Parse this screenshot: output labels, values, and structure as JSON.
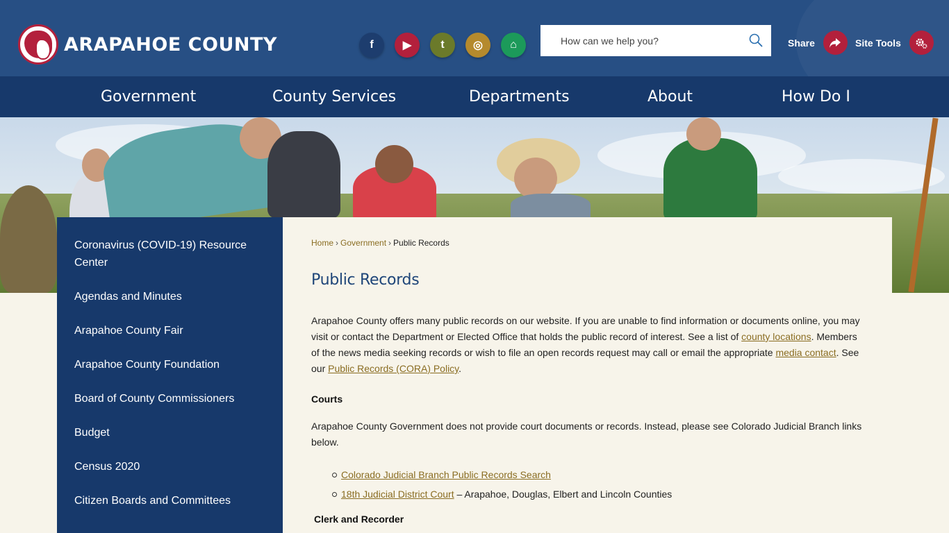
{
  "header": {
    "logo_text": "ARAPAHOE COUNTY",
    "socials": [
      {
        "name": "facebook",
        "glyph": "f"
      },
      {
        "name": "youtube",
        "glyph": "▶"
      },
      {
        "name": "twitter",
        "glyph": "t"
      },
      {
        "name": "instagram",
        "glyph": "◎"
      },
      {
        "name": "nextdoor",
        "glyph": "⌂"
      }
    ],
    "search_placeholder": "How can we help you?",
    "share_label": "Share",
    "site_tools_label": "Site Tools"
  },
  "nav": {
    "items": [
      "Government",
      "County Services",
      "Departments",
      "About",
      "How Do I"
    ]
  },
  "sidebar": {
    "items": [
      "Coronavirus (COVID-19) Resource Center",
      "Agendas and Minutes",
      "Arapahoe County Fair",
      "Arapahoe County Foundation",
      "Board of County Commissioners",
      "Budget",
      "Census 2020",
      "Citizen Boards and Committees"
    ]
  },
  "breadcrumb": {
    "home": "Home",
    "separator": "›",
    "government": "Government",
    "current": "Public Records"
  },
  "page": {
    "title": "Public Records",
    "intro_1": "Arapahoe County offers many public records on our website. If you are unable to find information or documents online, you may visit or contact the Department or Elected Office that holds the public record of interest. See a list of ",
    "intro_link_1": "county locations",
    "intro_2": ". Members of the news media seeking records or wish to file an open records request may call or email the appropriate ",
    "intro_link_2": "media contact",
    "intro_3": ". See our ",
    "intro_link_3": "Public Records (CORA) Policy",
    "intro_4": ".",
    "courts_heading": "Courts",
    "courts_text": "Arapahoe County Government does not provide court documents or records. Instead, please see Colorado Judicial Branch links below.",
    "court_link_1": "Colorado Judicial Branch Public Records Search",
    "court_link_2": "18th Judicial District Court",
    "court_link_2_suffix": " – Arapahoe, Douglas, Elbert and Lincoln Counties",
    "clerk_heading": "Clerk and Recorder"
  },
  "colors": {
    "header_bg": "#274f84",
    "nav_bg": "#17396b",
    "accent_red": "#b3203c",
    "link_gold": "#8a6d22",
    "title_blue": "#1f4679",
    "page_bg": "#f7f4ea"
  }
}
